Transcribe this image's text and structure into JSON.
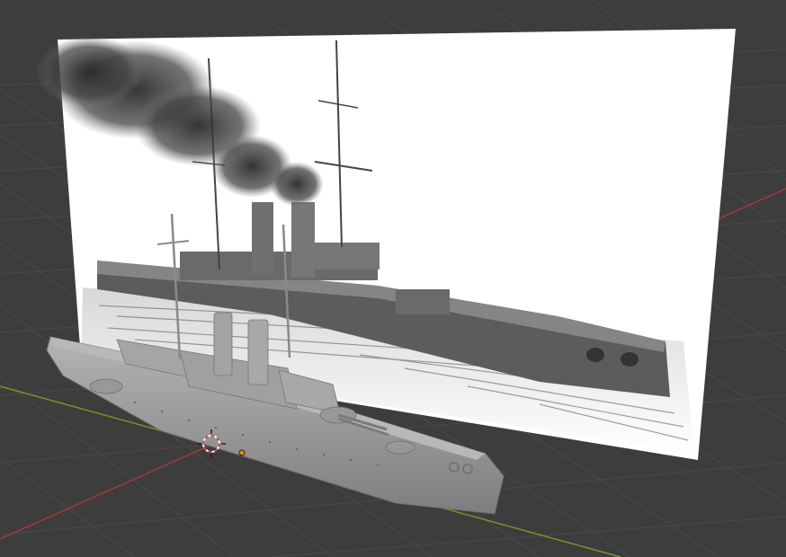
{
  "viewport": {
    "background": "#3d3d3d",
    "grid_color": "#4a4a4a",
    "x_axis_color": "#a03a3a",
    "y_axis_color": "#6f9a2a",
    "model_color": "#9c9c9c",
    "reference_background": "#ffffff",
    "smoke_color": "#2b2b2b",
    "cursor_color": "#d04848",
    "origin_color": "#e08a1e"
  },
  "icons": {
    "cursor": "3d-cursor-icon",
    "origin": "object-origin-icon"
  }
}
